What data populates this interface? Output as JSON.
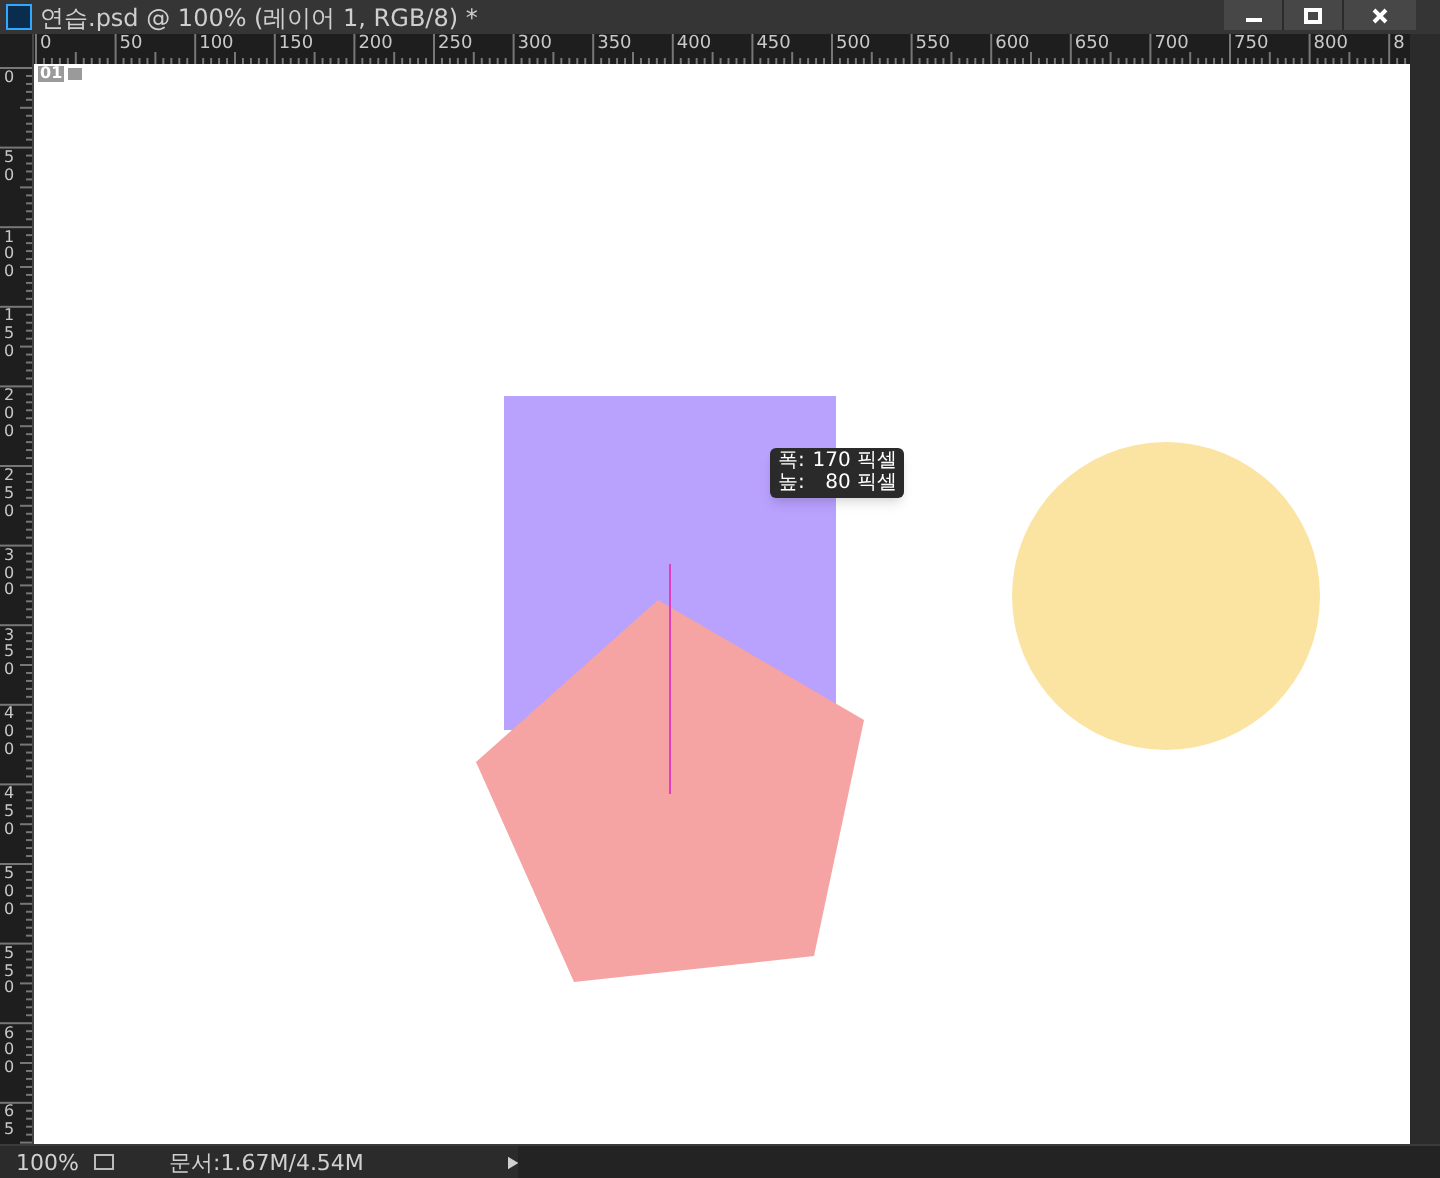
{
  "window": {
    "title": "연습.psd @ 100% (레이어 1, RGB/8) *"
  },
  "top_ruler": {
    "labels": [
      "0",
      "50",
      "100",
      "150",
      "200",
      "250",
      "300",
      "350",
      "400",
      "450",
      "500",
      "550",
      "600",
      "650",
      "700",
      "750",
      "800",
      "8"
    ]
  },
  "left_ruler": {
    "labels": [
      "0",
      "50",
      "100",
      "150",
      "200",
      "250",
      "300",
      "350",
      "400",
      "450",
      "500",
      "550",
      "600",
      "65"
    ]
  },
  "canvas": {
    "badge": "01"
  },
  "tooltip": {
    "lines": [
      {
        "label": "폭:",
        "value": "170",
        "unit": "픽셀"
      },
      {
        "label": "높:",
        "value": "80",
        "unit": "픽셀"
      }
    ]
  },
  "status_bar": {
    "zoom": "100%",
    "doc_info": "문서:1.67M/4.54M"
  }
}
